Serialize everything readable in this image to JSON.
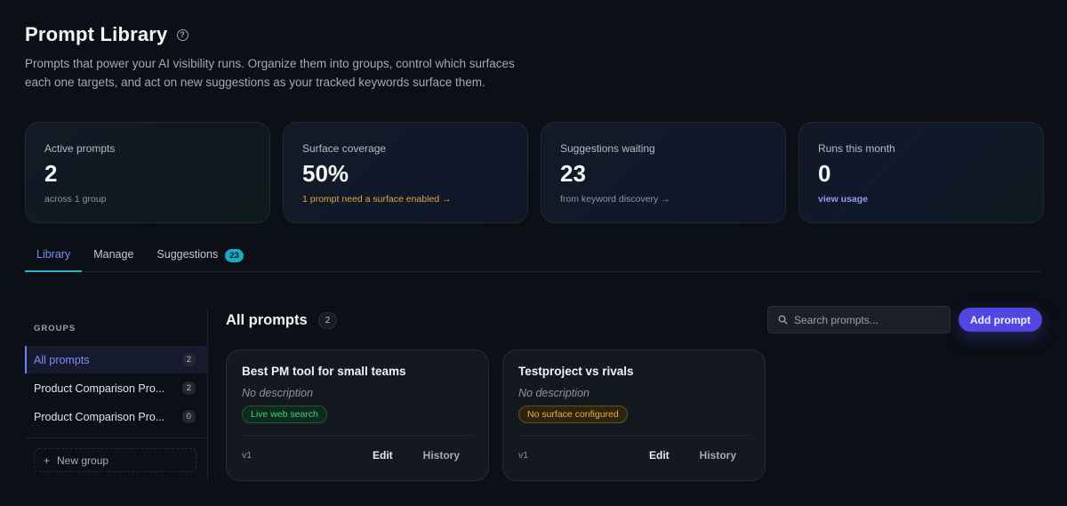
{
  "header": {
    "title": "Prompt Library",
    "help_icon": "?",
    "subtitle": "Prompts that power your AI visibility runs. Organize them into groups, control which surfaces each one targets, and act on new suggestions as your tracked keywords surface them."
  },
  "stats": [
    {
      "label": "Active prompts",
      "value": "2",
      "sub": "across 1 group"
    },
    {
      "label": "Surface coverage",
      "value": "50%",
      "sub": "1 prompt need a surface enabled →",
      "sub_color": "#e5a63a"
    },
    {
      "label": "Suggestions waiting",
      "value": "23",
      "sub": "from keyword discovery →"
    },
    {
      "label": "Runs this month",
      "value": "0",
      "sub": "view usage",
      "sub_color": "#8d9cf5"
    }
  ],
  "tabs": [
    {
      "label": "Library",
      "active": true
    },
    {
      "label": "Manage"
    },
    {
      "label": "Suggestions",
      "badge": "23"
    }
  ],
  "sidebar": {
    "heading": "GROUPS",
    "groups": [
      {
        "label": "All prompts",
        "count": "2",
        "active": true
      },
      {
        "label": "Product Comparison Pro...",
        "count": "2"
      },
      {
        "label": "Product Comparison Pro...",
        "count": "0"
      }
    ],
    "new_group": "New group",
    "new_group_icon": "+"
  },
  "main": {
    "title": "All prompts",
    "count": "2",
    "search_placeholder": "Search prompts...",
    "add_button": "Add prompt",
    "cards": [
      {
        "title": "Best PM tool for small teams",
        "description": "No description",
        "surface": "Live web search",
        "surface_color": "#3fcf7b",
        "version": "v1",
        "edit": "Edit",
        "history": "History"
      },
      {
        "title": "Testproject vs rivals",
        "description": "No description",
        "surface": "No surface configured",
        "surface_color": "#e4b13b",
        "version": "v1",
        "edit": "Edit",
        "history": "History"
      }
    ]
  },
  "colors": {
    "accent": "#5246e3",
    "tab_active": "#7b8df6",
    "badge": "#18a9c4"
  }
}
